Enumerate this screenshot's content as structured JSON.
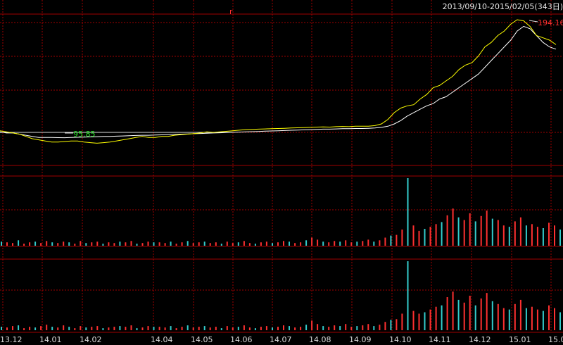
{
  "header": {
    "date_range": "2013/09/10-2015/02/05(343日)",
    "marker_glyph": "r"
  },
  "colors": {
    "background": "#000000",
    "grid": "#a00000",
    "price_line": "#ffffff",
    "index_line": "#ffff00",
    "vol_up": "#ff3030",
    "vol_down": "#33cccc",
    "max_label": "#ff3030",
    "min_label": "#22e022"
  },
  "chart_data": {
    "type": "line",
    "x_ticks": [
      "13.12",
      "14.01",
      "14.02",
      "14.04",
      "14.05",
      "14.06",
      "14.07",
      "14.08",
      "14.09",
      "14.10",
      "14.11",
      "14.12",
      "15.01",
      "15.0"
    ],
    "max_label": "194.16",
    "min_label": "95.85",
    "ylim": [
      90,
      200
    ],
    "series": [
      {
        "key": "white",
        "values": [
          101,
          100,
          100,
          99,
          98,
          97,
          96,
          96,
          96,
          95.9,
          95.85,
          96,
          96.2,
          96.4,
          96.6,
          96.8,
          97,
          97,
          97.2,
          97.4,
          97.6,
          97.8,
          98,
          98,
          98.2,
          98.4,
          98.6,
          98.8,
          99,
          99.2,
          99.4,
          99.6,
          99.8,
          100,
          100.2,
          100.4,
          100.6,
          100.8,
          101,
          101.2,
          101.4,
          101.6,
          101.8,
          102,
          102.2,
          102.4,
          102.6,
          102.8,
          103,
          103.2,
          103.4,
          103.4,
          103.6,
          103.8,
          103.8,
          104,
          104,
          104.2,
          104.5,
          105,
          106,
          108,
          111,
          115,
          118,
          121,
          124,
          126,
          130,
          132,
          136,
          140,
          144,
          148,
          152,
          158,
          164,
          170,
          176,
          182,
          190,
          194.16,
          192,
          186,
          180,
          176,
          174
        ]
      },
      {
        "key": "yellow",
        "values": [
          102,
          101,
          100,
          99,
          97,
          95,
          94,
          93,
          92,
          92,
          92.5,
          93,
          93,
          92,
          91.5,
          91,
          91.5,
          92,
          93,
          94,
          95,
          96,
          97,
          96,
          96,
          97,
          97,
          98,
          98.5,
          99,
          99.5,
          100,
          101,
          100.5,
          101,
          101.5,
          102,
          102.5,
          103,
          103.2,
          103.4,
          103.6,
          103.8,
          104,
          104.2,
          104.4,
          104.6,
          104.8,
          105,
          105.2,
          105.4,
          105.2,
          105.6,
          105.8,
          105.6,
          106,
          106,
          106,
          106.5,
          108,
          112,
          118,
          122,
          124,
          125,
          130,
          134,
          140,
          142,
          146,
          150,
          156,
          160,
          162,
          168,
          176,
          180,
          186,
          190,
          196,
          200,
          199,
          194,
          186,
          184,
          182,
          178
        ]
      }
    ],
    "volume_panels": [
      {
        "ylim": [
          0,
          100
        ],
        "values": [
          6,
          5,
          4,
          8,
          3,
          5,
          6,
          4,
          7,
          5,
          4,
          6,
          5,
          3,
          7,
          4,
          5,
          6,
          3,
          5,
          4,
          6,
          5,
          7,
          3,
          4,
          6,
          5,
          5,
          4,
          6,
          3,
          5,
          7,
          4,
          5,
          6,
          4,
          5,
          3,
          6,
          4,
          5,
          7,
          4,
          3,
          5,
          6,
          4,
          5,
          7,
          6,
          4,
          5,
          8,
          12,
          9,
          6,
          5,
          7,
          6,
          8,
          5,
          6,
          7,
          9,
          6,
          8,
          12,
          15,
          16,
          24,
          100,
          30,
          22,
          25,
          28,
          32,
          35,
          45,
          55,
          42,
          38,
          48,
          36,
          44,
          52,
          40,
          38,
          30,
          28,
          36,
          42,
          30,
          32,
          28,
          26,
          34,
          30,
          24
        ]
      },
      {
        "ylim": [
          0,
          100
        ],
        "values": [
          5,
          4,
          6,
          7,
          3,
          5,
          4,
          6,
          8,
          5,
          4,
          7,
          5,
          3,
          6,
          4,
          5,
          6,
          3,
          4,
          5,
          6,
          5,
          7,
          3,
          4,
          6,
          5,
          5,
          4,
          6,
          3,
          5,
          7,
          4,
          5,
          6,
          4,
          5,
          3,
          6,
          4,
          5,
          7,
          4,
          3,
          5,
          6,
          4,
          5,
          7,
          6,
          4,
          5,
          8,
          14,
          9,
          6,
          5,
          7,
          6,
          9,
          5,
          6,
          7,
          9,
          6,
          8,
          12,
          15,
          16,
          24,
          100,
          28,
          24,
          26,
          30,
          34,
          36,
          48,
          56,
          44,
          40,
          50,
          36,
          46,
          54,
          42,
          38,
          32,
          30,
          38,
          44,
          32,
          34,
          30,
          28,
          36,
          32,
          26
        ]
      }
    ],
    "volume_colors": "alternating up/down"
  }
}
